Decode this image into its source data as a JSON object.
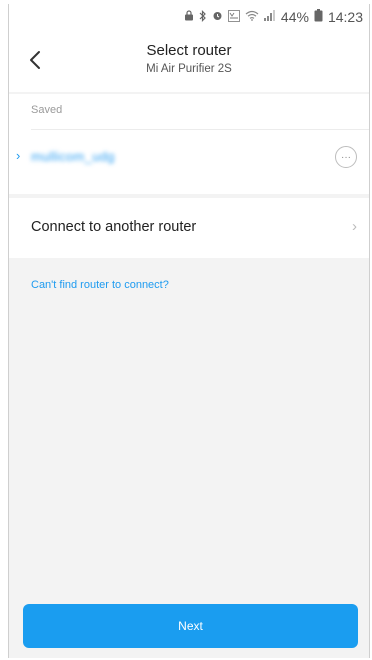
{
  "status_bar": {
    "icons": [
      "lock-icon",
      "bluetooth-icon",
      "alarm-icon",
      "volte-icon",
      "wifi-icon",
      "signal-icon"
    ],
    "battery_percent": "44%",
    "time": "14:23"
  },
  "header": {
    "title": "Select router",
    "subtitle": "Mi Air Purifier 2S"
  },
  "saved": {
    "section_label": "Saved",
    "network_name": "mullicom_udg"
  },
  "connect_another": {
    "label": "Connect to another router"
  },
  "help_link": "Can't find router to connect?",
  "next_button": "Next",
  "colors": {
    "accent": "#1a9df0",
    "background": "#f3f3f3",
    "card": "#ffffff"
  }
}
